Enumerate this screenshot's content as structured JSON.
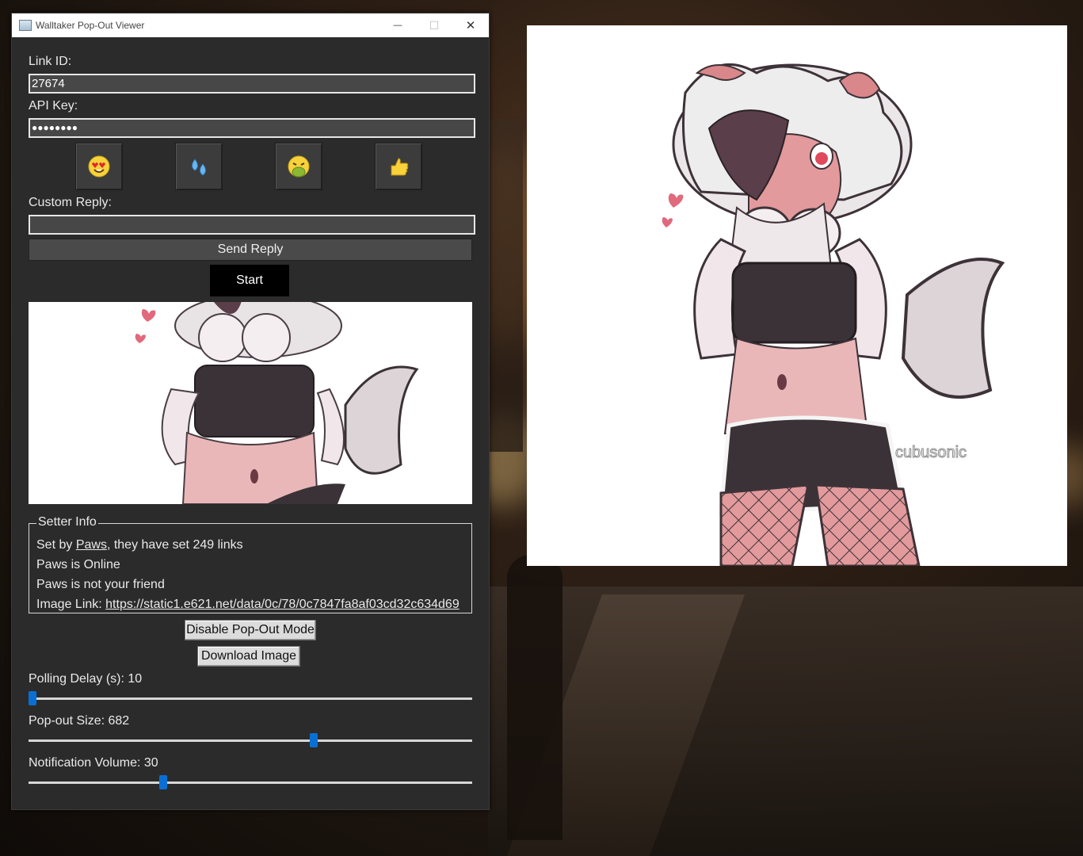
{
  "window": {
    "title": "Walltaker Pop-Out Viewer",
    "minimize_glyph": "—",
    "maximize_glyph": "☐",
    "close_glyph": "✕"
  },
  "form": {
    "link_id_label": "Link ID:",
    "link_id_value": "27674",
    "api_key_label": "API Key:",
    "api_key_value": "●●●●●●●●",
    "custom_reply_label": "Custom Reply:",
    "custom_reply_value": "",
    "send_reply_label": "Send Reply",
    "start_label": "Start"
  },
  "reactions": [
    {
      "icon": "heart-eyes-icon",
      "glyph": "😍"
    },
    {
      "icon": "sweat-droplets-icon",
      "glyph": "💦"
    },
    {
      "icon": "nauseated-face-icon",
      "glyph": "🤮"
    },
    {
      "icon": "thumbs-up-icon",
      "glyph": "👍"
    }
  ],
  "setter_info": {
    "legend": "Setter Info",
    "line1_prefix": "Set by ",
    "setter_name": "Paws",
    "line1_suffix": ", they have set 249 links",
    "online_status": "Paws is Online",
    "friend_status": "Paws is not your friend",
    "image_link_label": "Image Link: ",
    "image_link_url": "https://static1.e621.net/data/0c/78/0c7847fa8af03cd32c634d69"
  },
  "buttons": {
    "disable_popout": "Disable Pop-Out Mode",
    "download_image": "Download Image"
  },
  "sliders": {
    "polling_delay": {
      "label": "Polling Delay (s): 10",
      "value": 10,
      "fraction": 0.0
    },
    "popout_size": {
      "label": "Pop-out Size: 682",
      "value": 682,
      "fraction": 0.645
    },
    "notification_volume": {
      "label": "Notification Volume: 30",
      "value": 30,
      "fraction": 0.3
    }
  },
  "popout": {
    "watermark": "cubusonic"
  },
  "colors": {
    "accent": "#0a6fd4",
    "window_bg": "#2b2b2b",
    "character_pink": "#d9878a",
    "character_dark": "#3a3236"
  }
}
